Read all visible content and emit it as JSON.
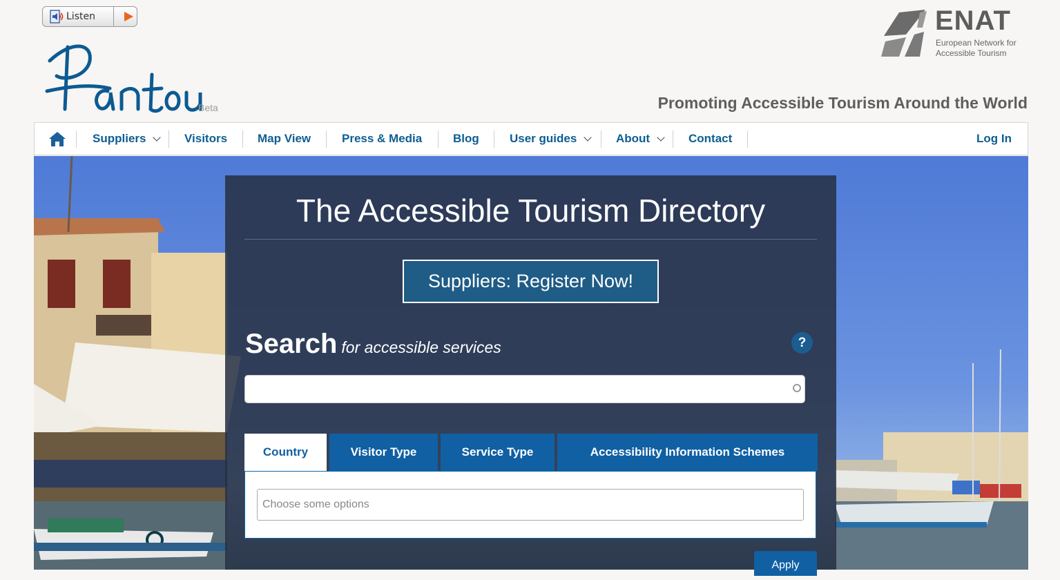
{
  "listen": {
    "label": "Listen"
  },
  "logo": {
    "name": "Pantou",
    "badge": "Beta"
  },
  "partner": {
    "name": "ENAT",
    "subtitle_line1": "European Network for",
    "subtitle_line2": "Accessible Tourism"
  },
  "tagline": "Promoting Accessible Tourism Around the World",
  "nav": {
    "items": [
      {
        "label": "Suppliers",
        "dropdown": true
      },
      {
        "label": "Visitors",
        "dropdown": false
      },
      {
        "label": "Map View",
        "dropdown": false
      },
      {
        "label": "Press & Media",
        "dropdown": false
      },
      {
        "label": "Blog",
        "dropdown": false
      },
      {
        "label": "User guides",
        "dropdown": true
      },
      {
        "label": "About",
        "dropdown": true
      },
      {
        "label": "Contact",
        "dropdown": false
      }
    ],
    "login": "Log In"
  },
  "hero": {
    "title": "The Accessible Tourism Directory",
    "register_button": "Suppliers: Register Now!",
    "search_heading": "Search",
    "search_subheading": "for accessible services",
    "help": "?",
    "search_value": "",
    "tabs": [
      "Country",
      "Visitor Type",
      "Service Type",
      "Accessibility Information Schemes"
    ],
    "active_tab": "Country",
    "options_placeholder": "Choose some options",
    "apply_button": "Apply"
  },
  "colors": {
    "nav_link": "#0c5e91",
    "tab_blue": "#1060a3",
    "panel": "#263042"
  },
  "icons": [
    "speaker-icon",
    "play-icon",
    "home-icon",
    "chevron-down-icon",
    "help-icon"
  ]
}
